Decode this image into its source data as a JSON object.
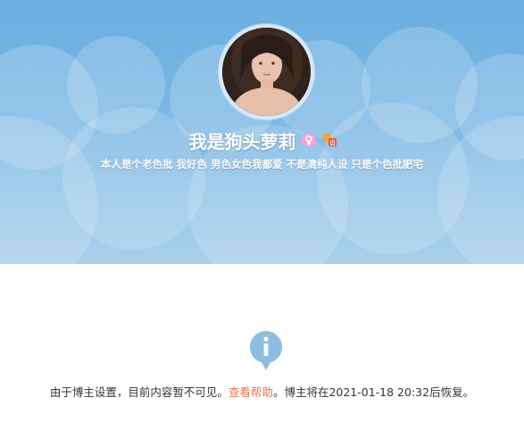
{
  "profile": {
    "name": "我是狗头萝莉",
    "bio": "本人是个老色批 我好色 男色女色我都爱 不是清纯人设 只是个色批肥宅",
    "badges": [
      "female-gender-icon",
      "vip-badge-icon"
    ]
  },
  "notice": {
    "text_before": "由于博主设置，目前内容暂不可见。",
    "help_link": "查看帮助",
    "text_after": "。博主将在2021-01-18 20:32后恢复。"
  },
  "colors": {
    "banner_top": "#6aaee0",
    "banner_bottom": "#a9d0ec",
    "link": "#eb7350",
    "info_icon": "#8fbde0",
    "text": "#333333"
  }
}
